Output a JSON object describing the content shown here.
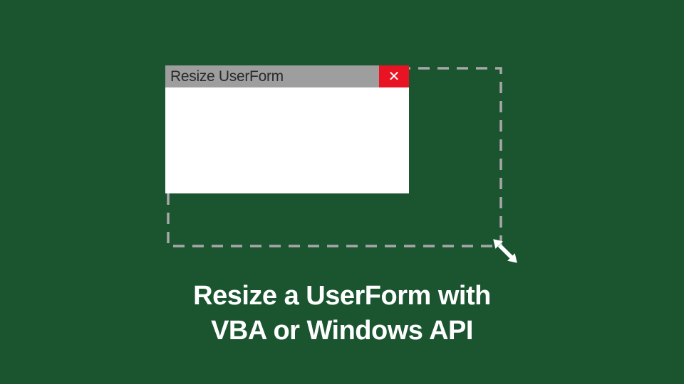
{
  "userform": {
    "title": "Resize UserForm",
    "close_symbol": "✕"
  },
  "caption": {
    "line1": "Resize a UserForm with",
    "line2": "VBA or Windows API"
  },
  "colors": {
    "background": "#1a5530",
    "titlebar": "#9e9e9e",
    "close_button": "#e81323",
    "dash_outline": "#a8a8a8"
  }
}
